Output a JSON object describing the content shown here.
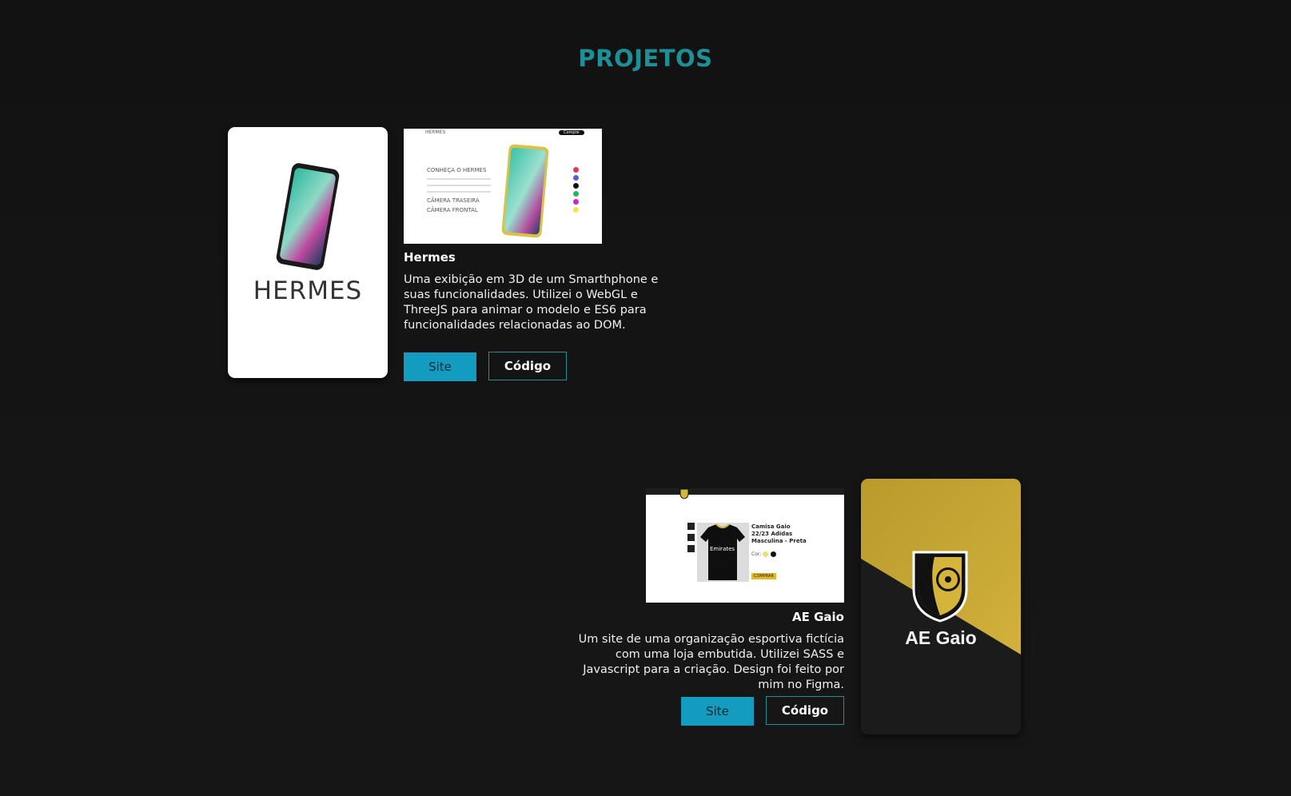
{
  "section": {
    "title": "PROJETOS"
  },
  "colors": {
    "accent": "#1f8f96",
    "site_button": "#139cc0",
    "background": "#141414",
    "gaio_gold": "#c9a632"
  },
  "projects": [
    {
      "id": "hermes",
      "card_logo_text": "HERMES",
      "name": "Hermes",
      "description": "Uma exibição em 3D de um Smarthphone e suas funcionalidades. Utilizei o WebGL e ThreeJS para animar o modelo e ES6 para funcionalidades relacionadas ao DOM.",
      "site_label": "Site",
      "code_label": "Código",
      "preview": {
        "brand": "HERMES",
        "button": "Compre",
        "heading": "CONHEÇA O HERMES",
        "line1": "CÂMERA TRASEIRA",
        "line2": "CÂMERA FRONTAL",
        "swatches": [
          "#e0384b",
          "#5b5bd6",
          "#111111",
          "#1fb85a",
          "#d61fd6",
          "#e8e84a"
        ]
      }
    },
    {
      "id": "ae-gaio",
      "card_logo_text": "AE Gaio",
      "name": "AE Gaio",
      "description": "Um site de uma organização esportiva fictícia com uma loja embutida. Utilizei SASS e Javascript para a criação. Design foi feito por mim no Figma.",
      "site_label": "Site",
      "code_label": "Código",
      "preview": {
        "product_title": "Camisa Gaio 22/23 Adidas Masculina - Preta",
        "color_label": "Cor:",
        "buy_button": "COMPRAR",
        "shirt_text": "Emirates"
      }
    }
  ]
}
